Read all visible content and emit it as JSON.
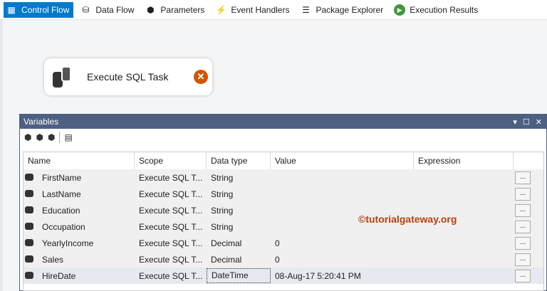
{
  "tabs": [
    {
      "label": "Control Flow",
      "icon": "control-flow-icon",
      "active": true
    },
    {
      "label": "Data Flow",
      "icon": "data-flow-icon"
    },
    {
      "label": "Parameters",
      "icon": "parameters-icon"
    },
    {
      "label": "Event Handlers",
      "icon": "event-handlers-icon"
    },
    {
      "label": "Package Explorer",
      "icon": "package-explorer-icon"
    },
    {
      "label": "Execution Results",
      "icon": "execution-results-icon"
    }
  ],
  "task": {
    "label": "Execute SQL Task",
    "status_icon": "error-icon"
  },
  "panel": {
    "title": "Variables"
  },
  "columns": {
    "name": "Name",
    "scope": "Scope",
    "type": "Data type",
    "value": "Value",
    "expr": "Expression"
  },
  "rows": [
    {
      "name": "FirstName",
      "scope": "Execute SQL T...",
      "type": "String",
      "value": "",
      "expr": "",
      "btn": "..."
    },
    {
      "name": "LastName",
      "scope": "Execute SQL T...",
      "type": "String",
      "value": "",
      "expr": "",
      "btn": "..."
    },
    {
      "name": "Education",
      "scope": "Execute SQL T...",
      "type": "String",
      "value": "",
      "expr": "",
      "btn": "..."
    },
    {
      "name": "Occupation",
      "scope": "Execute SQL T...",
      "type": "String",
      "value": "",
      "expr": "",
      "btn": "..."
    },
    {
      "name": "YearlyIncome",
      "scope": "Execute SQL T...",
      "type": "Decimal",
      "value": "0",
      "expr": "",
      "btn": "..."
    },
    {
      "name": "Sales",
      "scope": "Execute SQL T...",
      "type": "Decimal",
      "value": "0",
      "expr": "",
      "btn": "..."
    },
    {
      "name": "HireDate",
      "scope": "Execute SQL T...",
      "type": "DateTime",
      "value": "08-Aug-17 5:20:41 PM",
      "expr": "",
      "btn": "..."
    }
  ],
  "watermark": "©tutorialgateway.org"
}
